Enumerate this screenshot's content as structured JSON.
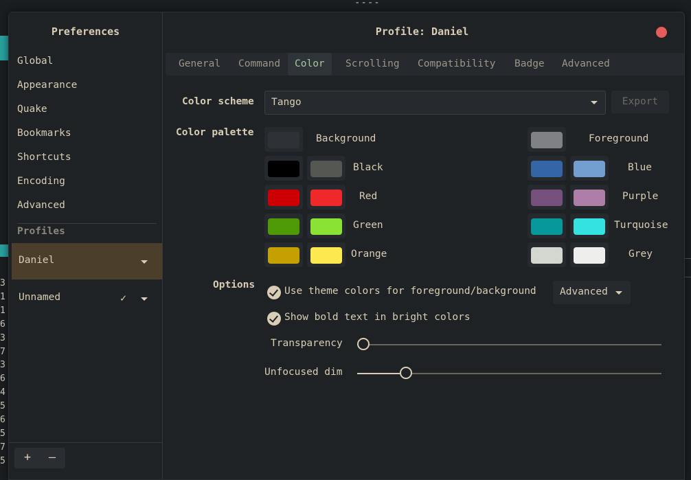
{
  "background": {
    "dashes": "----",
    "line_numbers": [
      "3",
      "1",
      "1",
      "6",
      "3",
      "7",
      "3",
      "6",
      "4",
      "5",
      "6",
      "5",
      "7",
      "5"
    ]
  },
  "sidebar": {
    "title": "Preferences",
    "items": [
      {
        "label": "Global"
      },
      {
        "label": "Appearance"
      },
      {
        "label": "Quake"
      },
      {
        "label": "Bookmarks"
      },
      {
        "label": "Shortcuts"
      },
      {
        "label": "Encoding"
      },
      {
        "label": "Advanced"
      }
    ],
    "profiles_label": "Profiles",
    "profiles": [
      {
        "name": "Daniel",
        "active": true
      },
      {
        "name": "Unnamed",
        "default": true
      }
    ],
    "add_label": "+",
    "remove_label": "–"
  },
  "main": {
    "title": "Profile: Daniel",
    "tabs": [
      {
        "label": "General"
      },
      {
        "label": "Command"
      },
      {
        "label": "Color",
        "active": true
      },
      {
        "label": "Scrolling"
      },
      {
        "label": "Compatibility"
      },
      {
        "label": "Badge"
      },
      {
        "label": "Advanced"
      }
    ],
    "color_scheme_label": "Color scheme",
    "color_scheme_value": "Tango",
    "export_label": "Export",
    "palette_label": "Color palette",
    "palette": {
      "background": {
        "label": "Background",
        "color": "#2e3136"
      },
      "foreground": {
        "label": "Foreground",
        "color": "#7f8185"
      },
      "left_rows": [
        {
          "label": "Black",
          "normal": "#000000",
          "bright": "#555753"
        },
        {
          "label": "Red",
          "normal": "#cc0000",
          "bright": "#ef2929"
        },
        {
          "label": "Green",
          "normal": "#4e9a06",
          "bright": "#8ae234"
        },
        {
          "label": "Orange",
          "normal": "#c4a000",
          "bright": "#fce94f"
        }
      ],
      "right_rows": [
        {
          "label": "Blue",
          "normal": "#3465a4",
          "bright": "#729fcf"
        },
        {
          "label": "Purple",
          "normal": "#75507b",
          "bright": "#ad7fa8"
        },
        {
          "label": "Turquoise",
          "normal": "#06989a",
          "bright": "#34e2e2"
        },
        {
          "label": "Grey",
          "normal": "#d3d7cf",
          "bright": "#eeeeec"
        }
      ]
    },
    "options_label": "Options",
    "option_theme_colors": {
      "label": "Use theme colors for foreground/background",
      "checked": true
    },
    "option_bold_bright": {
      "label": "Show bold text in bright colors",
      "checked": true
    },
    "advanced_label": "Advanced",
    "transparency": {
      "label": "Transparency",
      "value": 0.02
    },
    "unfocused_dim": {
      "label": "Unfocused dim",
      "value": 0.16
    }
  }
}
